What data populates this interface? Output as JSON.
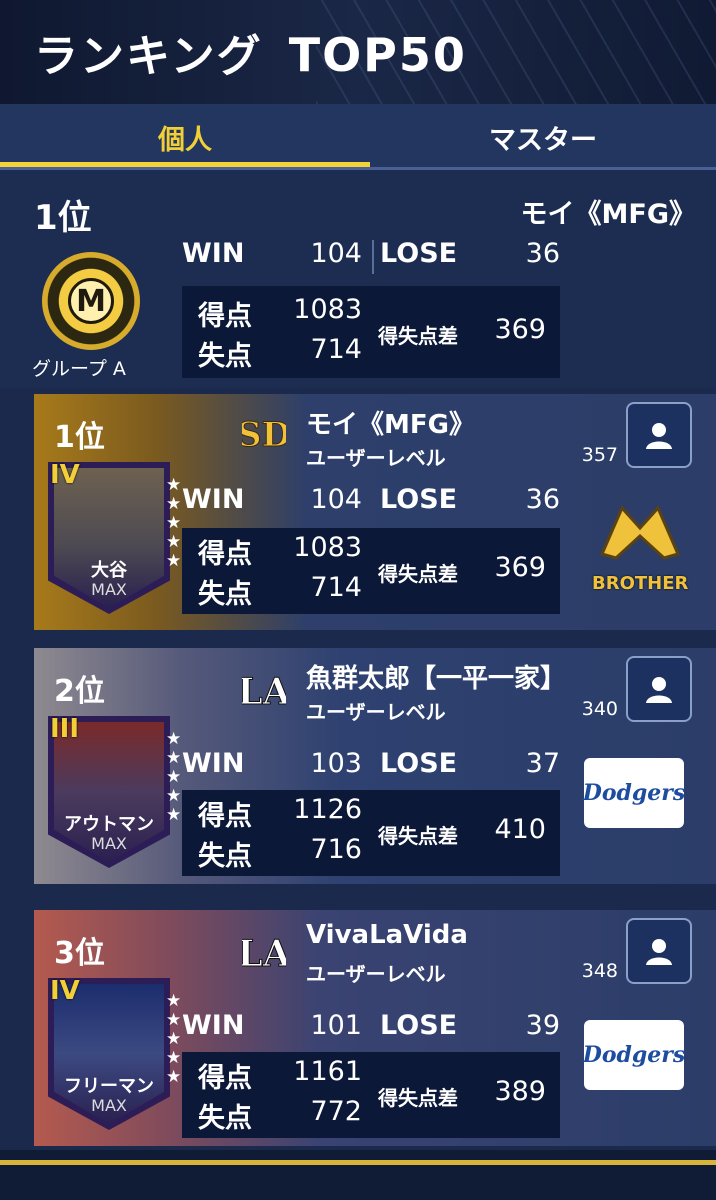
{
  "header": {
    "title": "ランキング",
    "title_suffix": "TOP50"
  },
  "tabs": [
    {
      "label": "個人",
      "active": true
    },
    {
      "label": "マスター",
      "active": false
    }
  ],
  "mine": {
    "rank": "1位",
    "name": "モイ《MFG》",
    "group": "グループ A",
    "win_label": "WIN",
    "win": "104",
    "lose_label": "LOSE",
    "lose": "36",
    "scored_label": "得点",
    "scored": "1083",
    "allowed_label": "失点",
    "allowed": "714",
    "diff_label": "得失点差",
    "diff": "369"
  },
  "ranking": [
    {
      "rank": "1位",
      "team_icon": "padres-logo",
      "name": "モイ《MFG》",
      "level_label": "ユーザーレベル",
      "level": "357",
      "player_grade": "IV",
      "player_name": "大谷",
      "player_max": "MAX",
      "win_label": "WIN",
      "win": "104",
      "lose_label": "LOSE",
      "lose": "36",
      "scored_label": "得点",
      "scored": "1083",
      "allowed_label": "失点",
      "allowed": "714",
      "diff_label": "得失点差",
      "diff": "369",
      "badge_text": "BROTHER",
      "badge_icon": "handshake-icon"
    },
    {
      "rank": "2位",
      "team_icon": "dodgers-la-logo",
      "name": "魚群太郎【一平一家】",
      "level_label": "ユーザーレベル",
      "level": "340",
      "player_grade": "III",
      "player_name": "アウトマン",
      "player_max": "MAX",
      "win_label": "WIN",
      "win": "103",
      "lose_label": "LOSE",
      "lose": "37",
      "scored_label": "得点",
      "scored": "1126",
      "allowed_label": "失点",
      "allowed": "716",
      "diff_label": "得失点差",
      "diff": "410",
      "badge_text": "Dodgers",
      "badge_icon": "dodgers-wordmark"
    },
    {
      "rank": "3位",
      "team_icon": "dodgers-la-logo",
      "name": "VivaLaVida",
      "level_label": "ユーザーレベル",
      "level": "348",
      "player_grade": "IV",
      "player_name": "フリーマン",
      "player_max": "MAX",
      "win_label": "WIN",
      "win": "101",
      "lose_label": "LOSE",
      "lose": "39",
      "scored_label": "得点",
      "scored": "1161",
      "allowed_label": "失点",
      "allowed": "772",
      "diff_label": "得失点差",
      "diff": "389",
      "badge_text": "Dodgers",
      "badge_icon": "dodgers-wordmark"
    }
  ],
  "colors": {
    "accent": "#f2cf36",
    "background": "#1b2a4c",
    "stat_box": "#0c1838"
  }
}
